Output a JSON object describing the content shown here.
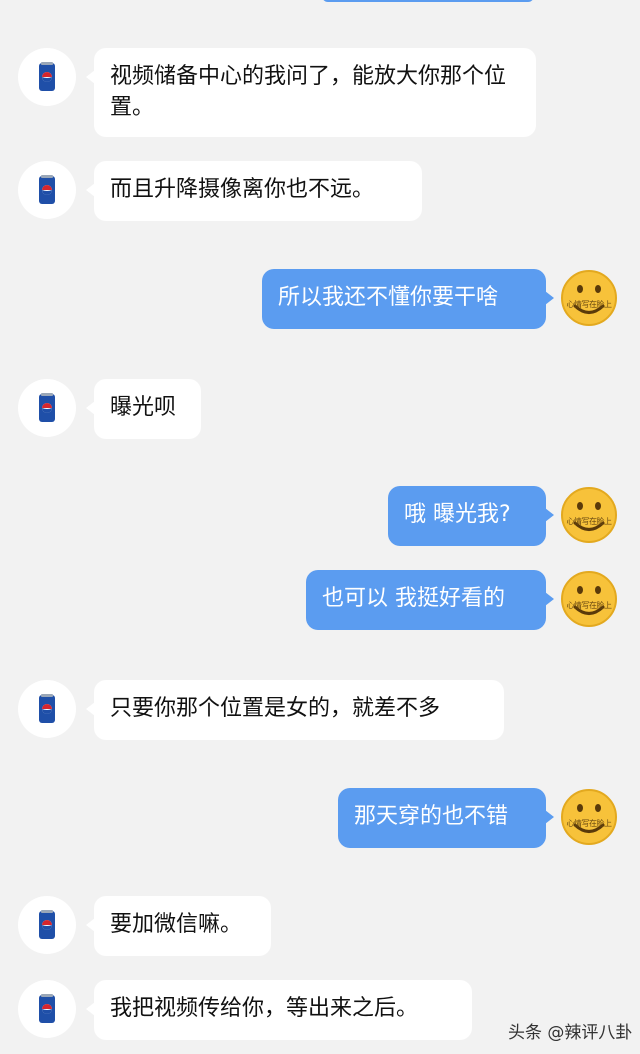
{
  "colors": {
    "background": "#f2f2f2",
    "incoming_bubble": "#ffffff",
    "outgoing_bubble": "#5b9cf0",
    "outgoing_text": "#ffffff"
  },
  "icons": {
    "incoming_avatar": "pepsi-can-icon",
    "outgoing_avatar": "smiley-face-icon"
  },
  "outgoing_avatar_caption": "心情写在脸上",
  "messages": [
    {
      "side": "left",
      "text": "视频储备中心的我问了，能放大你那个位置。"
    },
    {
      "side": "left",
      "text": "而且升降摄像离你也不远。"
    },
    {
      "side": "right",
      "text": "所以我还不懂你要干啥"
    },
    {
      "side": "left",
      "text": "曝光呗"
    },
    {
      "side": "right",
      "text": "哦 曝光我?"
    },
    {
      "side": "right",
      "text": "也可以 我挺好看的"
    },
    {
      "side": "left",
      "text": "只要你那个位置是女的，就差不多"
    },
    {
      "side": "right",
      "text": "那天穿的也不错"
    },
    {
      "side": "left",
      "text": "要加微信嘛。"
    },
    {
      "side": "left",
      "text": "我把视频传给你，等出来之后。"
    }
  ],
  "watermark": "头条 @辣评八卦"
}
